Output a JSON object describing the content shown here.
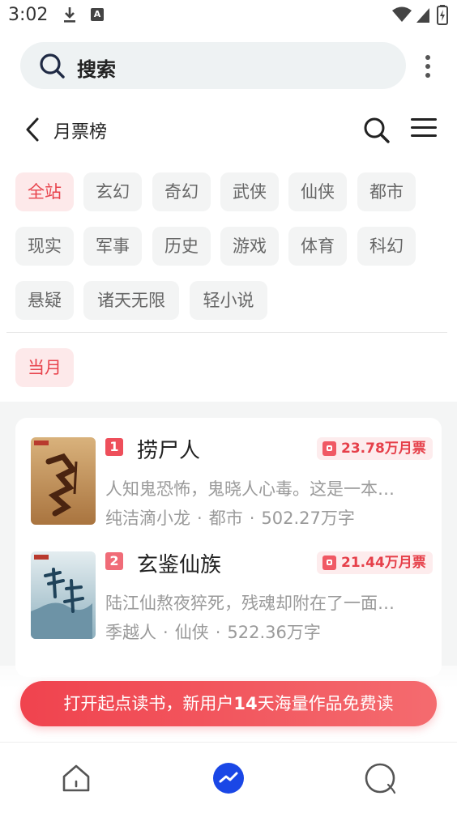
{
  "status_bar": {
    "time": "3:02",
    "a_badge": "A"
  },
  "search": {
    "placeholder": "搜索"
  },
  "header": {
    "title": "月票榜"
  },
  "categories": [
    "全站",
    "玄幻",
    "奇幻",
    "武侠",
    "仙侠",
    "都市",
    "现实",
    "军事",
    "历史",
    "游戏",
    "体育",
    "科幻",
    "悬疑",
    "诸天无限",
    "轻小说"
  ],
  "active_category": "全站",
  "period": "当月",
  "books": [
    {
      "rank": "1",
      "title": "捞尸人",
      "votes": "23.78万月票",
      "description": "人知鬼恐怖，鬼晓人心毒。这是一本…",
      "author": "纯洁滴小龙",
      "genre": "都市",
      "words": "502.27万字"
    },
    {
      "rank": "2",
      "title": "玄鉴仙族",
      "votes": "21.44万月票",
      "description": "陆江仙熬夜猝死，残魂却附在了一面…",
      "author": "季越人",
      "genre": "仙侠",
      "words": "522.36万字"
    }
  ],
  "promo": {
    "prefix": "打开起点读书，新用户",
    "days": "14",
    "suffix": "天海量作品免费读"
  },
  "colors": {
    "accent": "#e8434c",
    "chip_active_bg": "#fde9ea",
    "nav_active": "#1a47e6"
  },
  "bottom_nav": [
    "home-icon",
    "discover-icon",
    "profile-icon"
  ]
}
